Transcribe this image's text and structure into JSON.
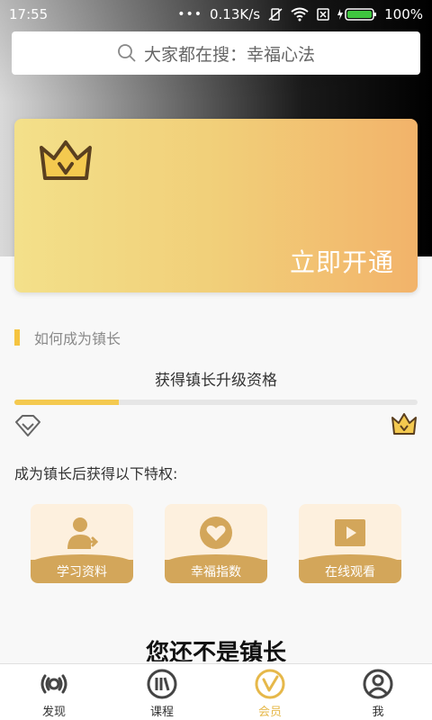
{
  "status": {
    "time": "17:55",
    "net_speed": "0.13K/s",
    "battery": "100%"
  },
  "search": {
    "placeholder": "大家都在搜：幸福心法"
  },
  "vip_card": {
    "action": "立即开通"
  },
  "section": {
    "title": "如何成为镇长"
  },
  "upgrade": {
    "label": "获得镇长升级资格",
    "progress": 0.26
  },
  "perks": {
    "title": "成为镇长后获得以下特权:",
    "items": [
      {
        "label": "学习资料",
        "icon": "learning-material-icon"
      },
      {
        "label": "幸福指数",
        "icon": "heart-icon"
      },
      {
        "label": "在线观看",
        "icon": "video-play-icon"
      }
    ]
  },
  "membership": {
    "status": "您还不是镇长"
  },
  "tabs": [
    {
      "label": "发现",
      "icon": "discover-icon"
    },
    {
      "label": "课程",
      "icon": "course-icon"
    },
    {
      "label": "会员",
      "icon": "member-icon",
      "active": true
    },
    {
      "label": "我",
      "icon": "profile-icon"
    }
  ],
  "colors": {
    "accent": "#e6b84a",
    "progress": "#f4c94f",
    "perk_label": "#d3a65a"
  }
}
